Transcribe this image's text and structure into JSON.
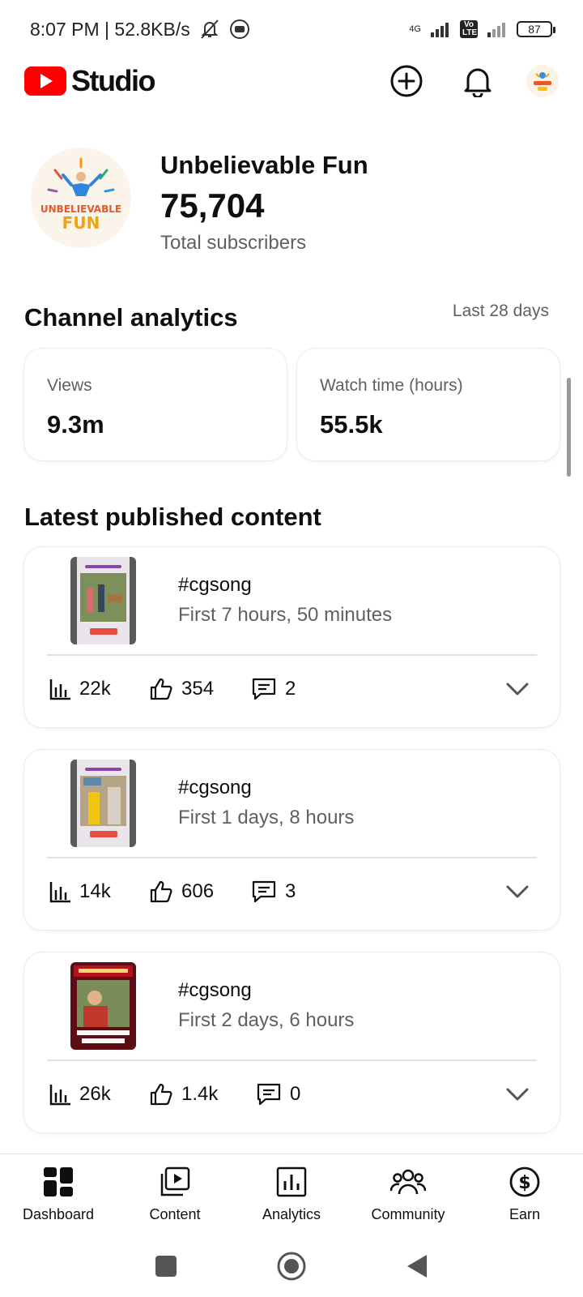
{
  "status_bar": {
    "time_speed": "8:07 PM | 52.8KB/s",
    "network_label": "4G",
    "volte_label": "Vo LTE",
    "battery": "87"
  },
  "app": {
    "logo_text": "Studio",
    "brand_color": "#ff0000"
  },
  "channel": {
    "name": "Unbelievable Fun",
    "subscribers": "75,704",
    "subscribers_label": "Total subscribers",
    "logo_text_top": "UNBELIEVABLE",
    "logo_text_bottom": "FUN"
  },
  "analytics": {
    "title": "Channel analytics",
    "period": "Last 28 days",
    "cards": [
      {
        "label": "Views",
        "value": "9.3m"
      },
      {
        "label": "Watch time (hours)",
        "value": "55.5k"
      }
    ]
  },
  "latest": {
    "title": "Latest published content",
    "items": [
      {
        "title": "#cgsong",
        "subtitle": "First 7 hours, 50 minutes",
        "views": "22k",
        "likes": "354",
        "comments": "2"
      },
      {
        "title": "#cgsong",
        "subtitle": "First 1 days, 8 hours",
        "views": "14k",
        "likes": "606",
        "comments": "3"
      },
      {
        "title": "#cgsong",
        "subtitle": "First 2 days, 6 hours",
        "views": "26k",
        "likes": "1.4k",
        "comments": "0"
      }
    ]
  },
  "nav": {
    "items": [
      {
        "label": "Dashboard",
        "icon": "dashboard-icon"
      },
      {
        "label": "Content",
        "icon": "content-icon"
      },
      {
        "label": "Analytics",
        "icon": "analytics-icon"
      },
      {
        "label": "Community",
        "icon": "community-icon"
      },
      {
        "label": "Earn",
        "icon": "earn-icon"
      }
    ]
  }
}
